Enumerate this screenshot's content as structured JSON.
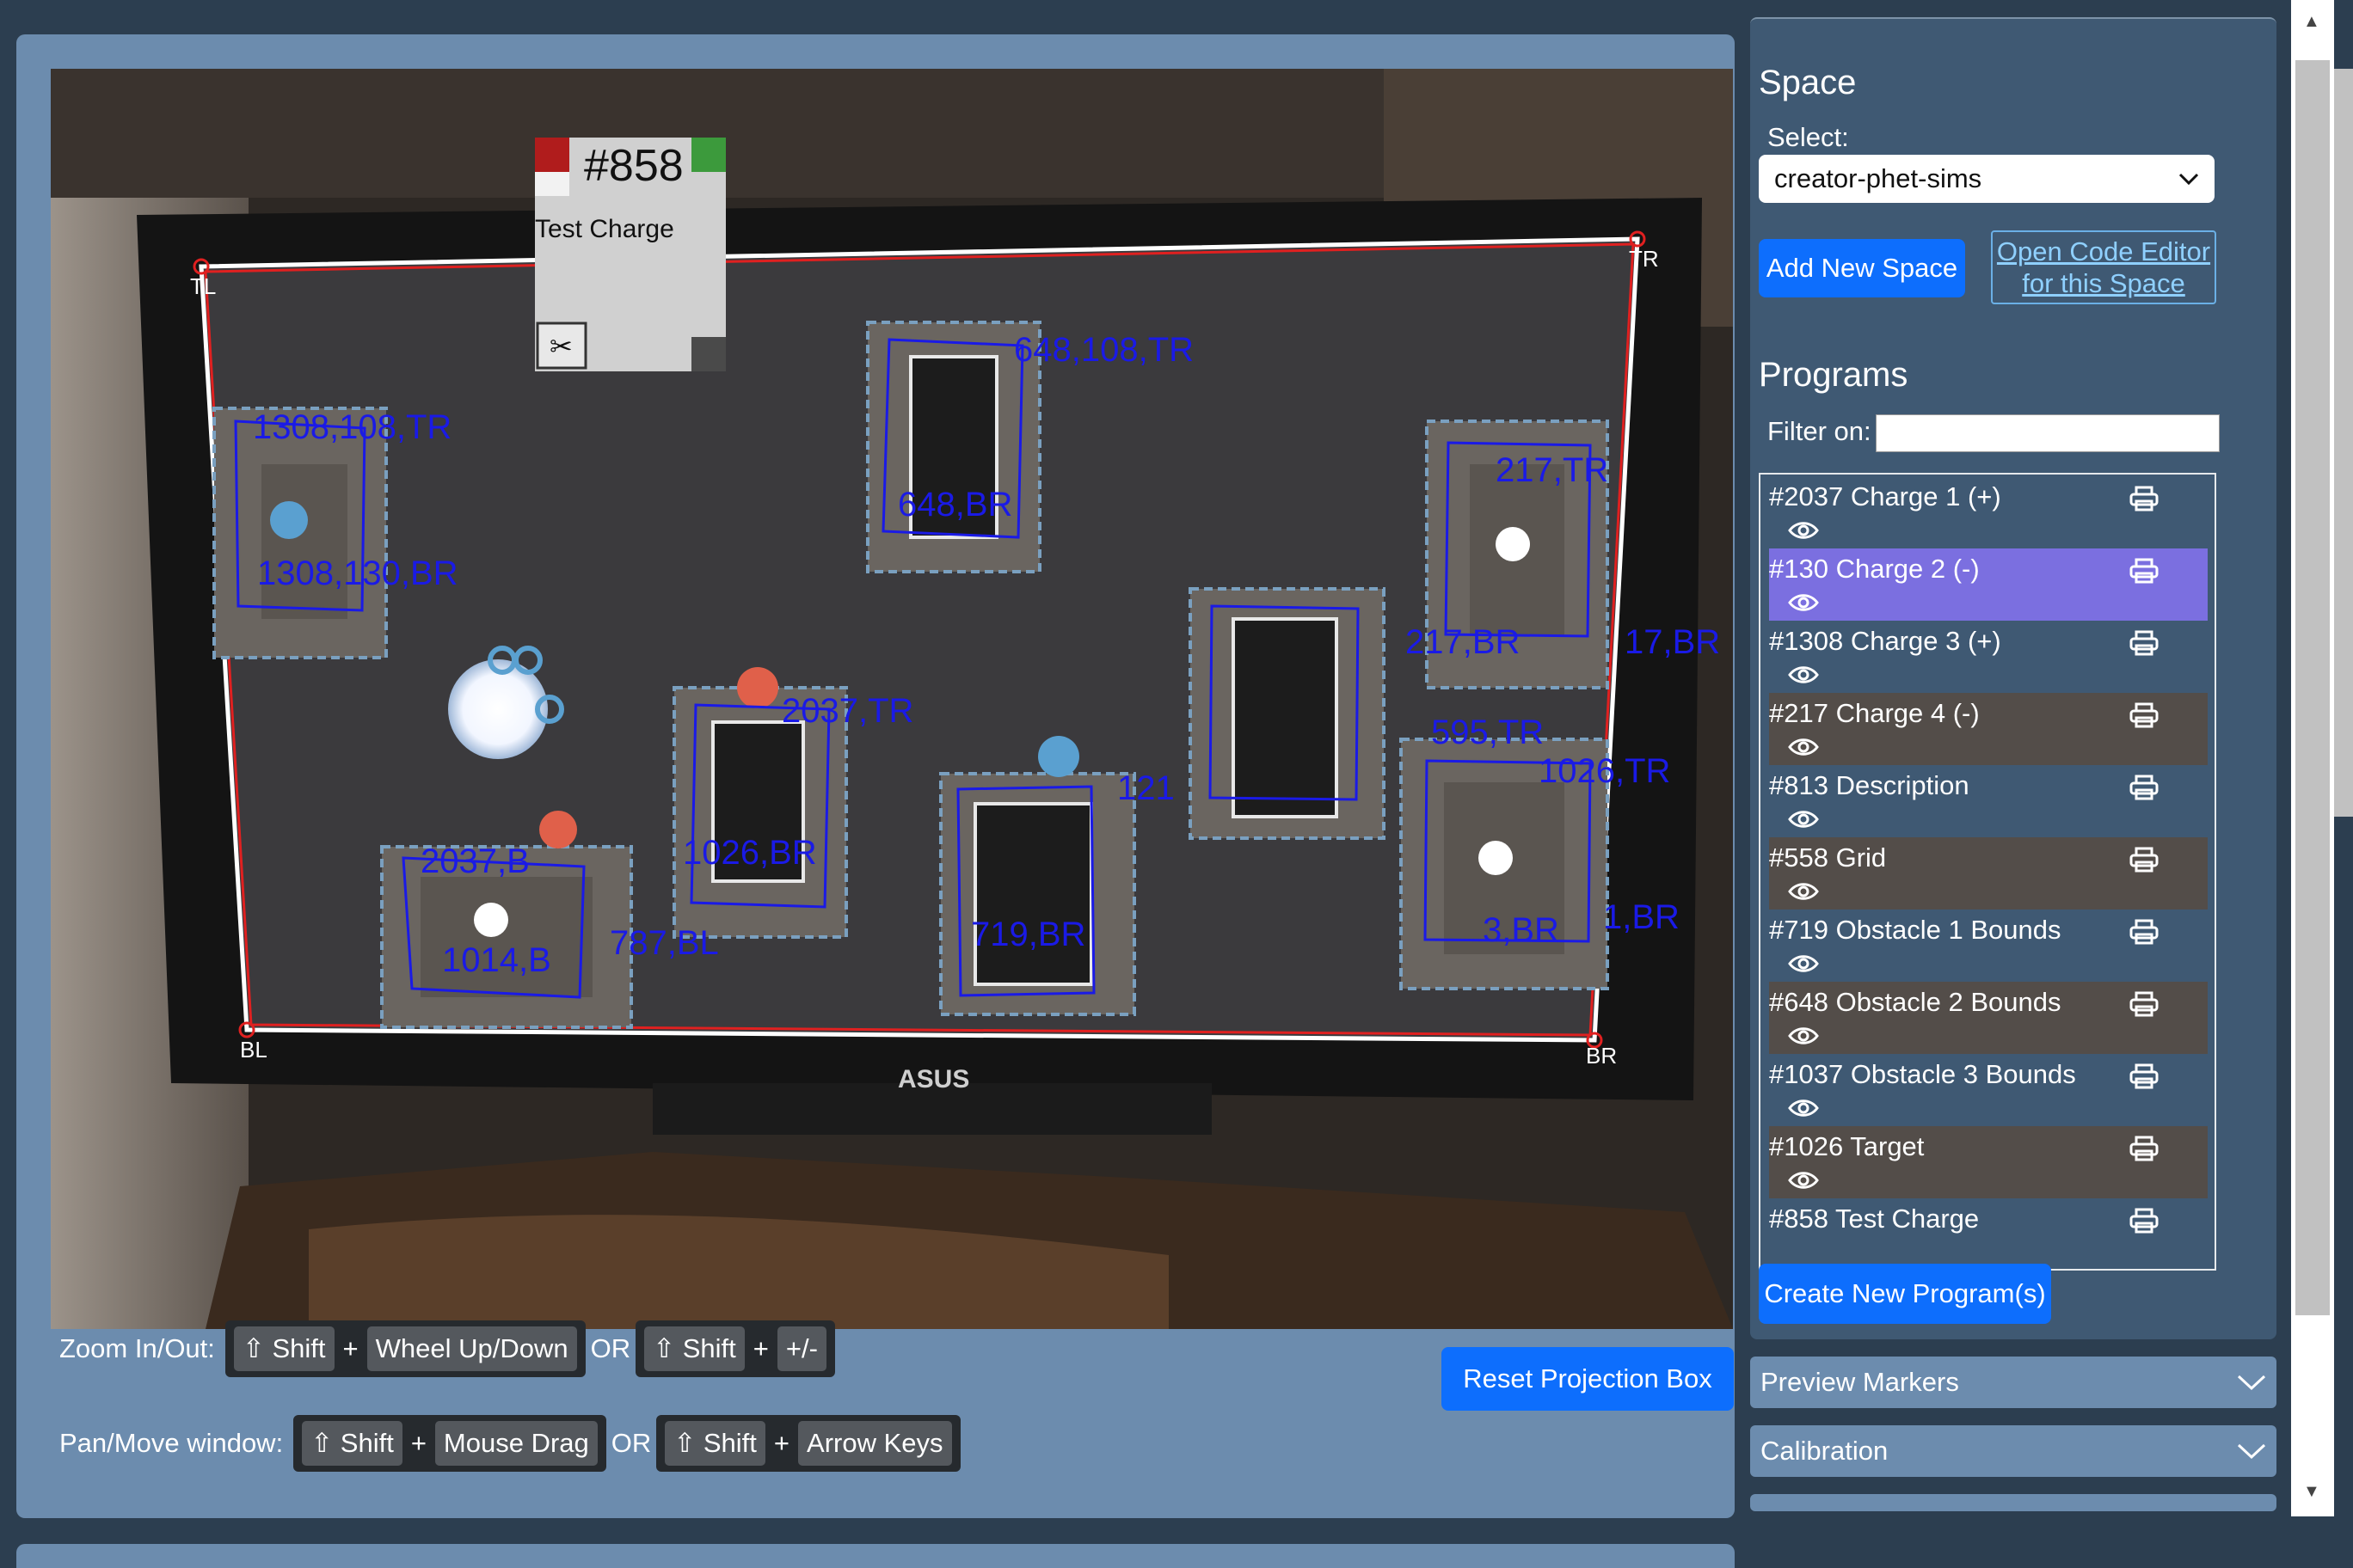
{
  "camera": {
    "corners": {
      "tl": "TL",
      "tr": "TR",
      "bl": "BL",
      "br": "BR"
    },
    "brand": "ASUS",
    "program_card": {
      "id": "#858",
      "name": "Test Charge",
      "scissors": "✂"
    },
    "overlay_labels": [
      "1308,108,TR",
      "1308,130,BR",
      "648,108,TR",
      "648,BR",
      "2037,B",
      "1014,B",
      "787,BL",
      "2037,TR",
      "1026,BR",
      "719,BR",
      "121",
      "1026,TR",
      "595,TR",
      "1,BR",
      "3,BR",
      "217,TR",
      "217,BR",
      "17,BR"
    ]
  },
  "help": {
    "zoom_label": "Zoom In/Out:",
    "pan_label": "Pan/Move window:",
    "shift": "⇧ Shift",
    "plus": "+",
    "or": "OR",
    "wheel": "Wheel Up/Down",
    "plusminus": "+/-",
    "mouse_drag": "Mouse Drag",
    "arrow_keys": "Arrow Keys"
  },
  "reset_button": "Reset Projection Box",
  "sidebar": {
    "space_heading": "Space",
    "select_label": "Select:",
    "selected_space": "creator-phet-sims",
    "add_space": "Add New Space",
    "code_editor_line1": "Open Code Editor",
    "code_editor_line2": "for this Space",
    "programs_heading": "Programs",
    "filter_label": "Filter on:",
    "filter_value": "",
    "programs": [
      {
        "name": "#2037 Charge 1 (+)",
        "selected": false
      },
      {
        "name": "#130 Charge 2 (-)",
        "selected": true
      },
      {
        "name": "#1308 Charge 3 (+)",
        "selected": false
      },
      {
        "name": "#217 Charge 4 (-)",
        "selected": false
      },
      {
        "name": "#813 Description",
        "selected": false
      },
      {
        "name": "#558 Grid",
        "selected": false
      },
      {
        "name": "#719 Obstacle 1 Bounds",
        "selected": false
      },
      {
        "name": "#648 Obstacle 2 Bounds",
        "selected": false
      },
      {
        "name": "#1037 Obstacle 3 Bounds",
        "selected": false
      },
      {
        "name": "#1026 Target",
        "selected": false
      },
      {
        "name": "#858 Test Charge",
        "selected": false
      }
    ],
    "create_program": "Create New Program(s)",
    "accordions": [
      "Preview Markers",
      "Calibration"
    ]
  },
  "colors": {
    "accent": "#0d6efd",
    "panel": "#6c8cae",
    "sidebar": "#3f5973",
    "selected_row": "#7b6fe0",
    "alt_row": "#534d49",
    "marker_blue": "#1a1ae6",
    "projection_line": "#e02020"
  }
}
